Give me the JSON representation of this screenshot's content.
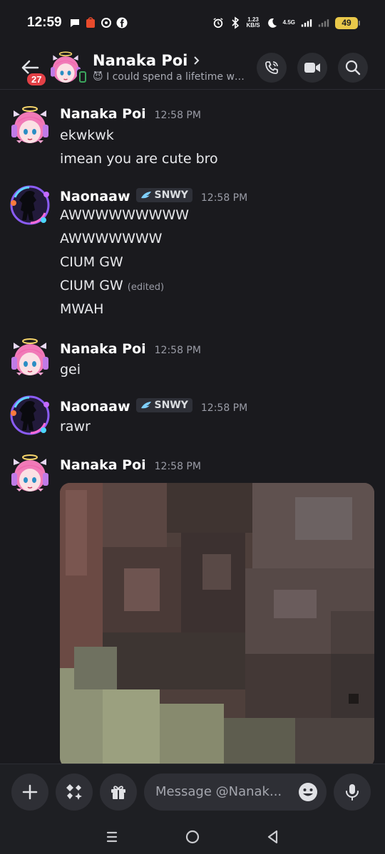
{
  "status_bar": {
    "time": "12:59",
    "speed_top": "1.23",
    "speed_bottom": "KB/S",
    "network": "4.5G",
    "battery": "49"
  },
  "header": {
    "unread_badge": "27",
    "name": "Nanaka Poi",
    "status_emoji": "😈",
    "status_text": "I could spend a lifetime wa..."
  },
  "messages": [
    {
      "author": "Nanaka Poi",
      "time": "12:58 PM",
      "lines": [
        "ekwkwk",
        "imean you are cute bro"
      ]
    },
    {
      "author": "Naonaaw",
      "tag": "SNWY",
      "time": "12:58 PM",
      "lines": [
        "AWWWWWWWWW",
        "AWWWWWWW",
        "CIUM GW",
        "CIUM GW",
        "MWAH"
      ],
      "edited_label": "(edited)"
    },
    {
      "author": "Nanaka Poi",
      "time": "12:58 PM",
      "lines": [
        "gei"
      ]
    },
    {
      "author": "Naonaaw",
      "tag": "SNWY",
      "time": "12:58 PM",
      "lines": [
        "rawr"
      ]
    },
    {
      "author": "Nanaka Poi",
      "time": "12:58 PM"
    }
  ],
  "composer": {
    "placeholder": "Message @Nanak..."
  },
  "colors": {
    "background": "#1a1a1e",
    "badge": "#e34046",
    "battery": "#e9c84a",
    "surface": "#2e2f35"
  }
}
